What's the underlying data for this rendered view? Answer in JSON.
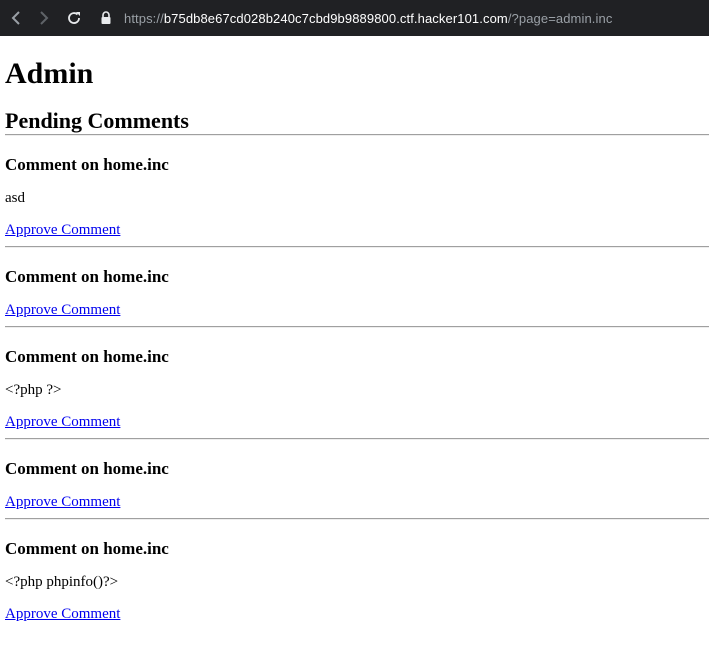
{
  "browser": {
    "url_prefix": "https://",
    "url_host": "b75db8e67cd028b240c7cbd9b9889800.ctf.hacker101.com",
    "url_path": "/?page=admin.inc"
  },
  "page": {
    "title": "Admin",
    "section_title": "Pending Comments"
  },
  "comments": [
    {
      "heading": "Comment on home.inc",
      "body": "asd",
      "action": "Approve Comment"
    },
    {
      "heading": "Comment on home.inc",
      "body": "",
      "action": "Approve Comment"
    },
    {
      "heading": "Comment on home.inc",
      "body": "<?php ?>",
      "action": "Approve Comment"
    },
    {
      "heading": "Comment on home.inc",
      "body": "",
      "action": "Approve Comment"
    },
    {
      "heading": "Comment on home.inc",
      "body": "<?php phpinfo()?>",
      "action": "Approve Comment"
    }
  ]
}
